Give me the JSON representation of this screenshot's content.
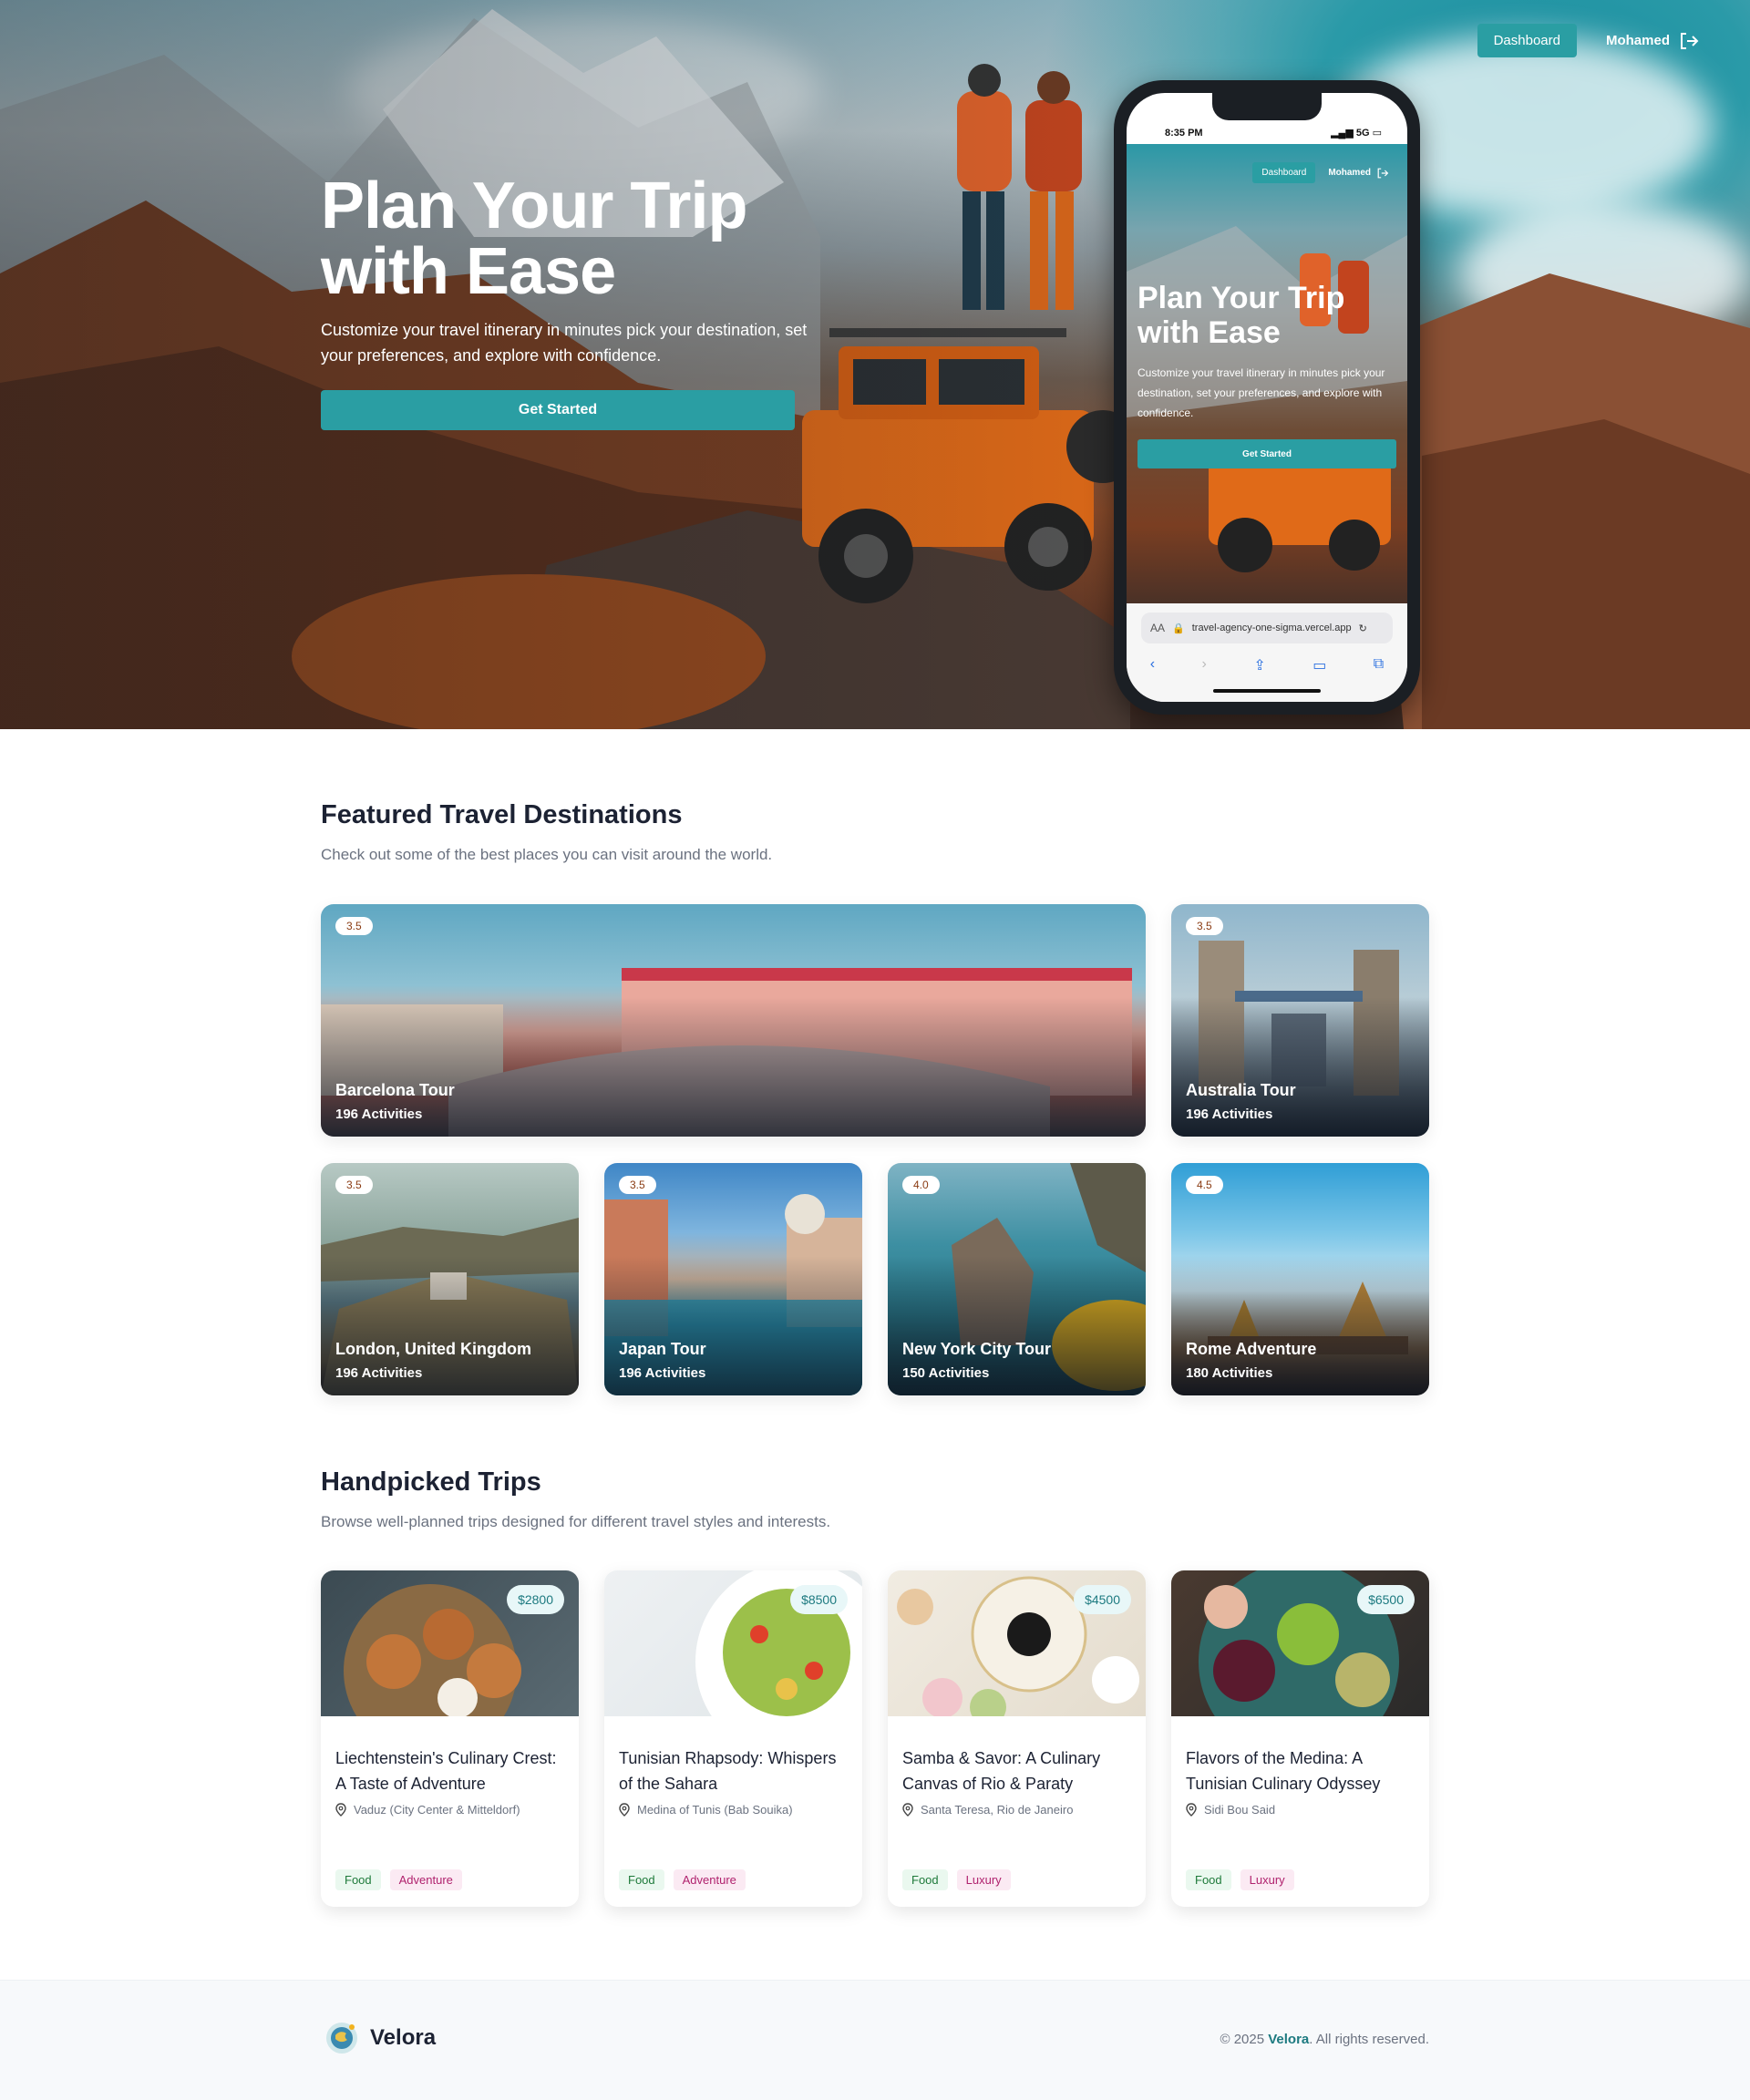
{
  "hero": {
    "nav": {
      "dashboard_label": "Dashboard",
      "user_name": "Mohamed"
    },
    "title": "Plan Your Trip with Ease",
    "subtitle": "Customize your travel itinerary in minutes pick your destination, set your preferences, and explore with confidence.",
    "cta_label": "Get Started"
  },
  "phone": {
    "time": "8:35 PM",
    "signal": "5G",
    "nav": {
      "dashboard_label": "Dashboard",
      "user_name": "Mohamed"
    },
    "title": "Plan Your Trip with Ease",
    "subtitle": "Customize your travel itinerary in minutes pick your destination, set your preferences, and explore with confidence.",
    "cta_label": "Get Started",
    "url_prefix": "AA",
    "url": "travel-agency-one-sigma.vercel.app"
  },
  "featured": {
    "title": "Featured Travel Destinations",
    "subtitle": "Check out some of the best places you can visit around the world.",
    "items": [
      {
        "rating": "3.5",
        "name": "Barcelona Tour",
        "activities": "196 Activities"
      },
      {
        "rating": "3.5",
        "name": "Australia Tour",
        "activities": "196 Activities"
      },
      {
        "rating": "3.5",
        "name": "London, United Kingdom",
        "activities": "196 Activities"
      },
      {
        "rating": "3.5",
        "name": "Japan Tour",
        "activities": "196 Activities"
      },
      {
        "rating": "4.0",
        "name": "New York City Tour",
        "activities": "150 Activities"
      },
      {
        "rating": "4.5",
        "name": "Rome Adventure",
        "activities": "180 Activities"
      }
    ]
  },
  "trips": {
    "title": "Handpicked Trips",
    "subtitle": "Browse well-planned trips designed for different travel styles and interests.",
    "items": [
      {
        "price": "$2800",
        "title": "Liechtenstein's Culinary Crest: A Taste of Adventure",
        "location": "Vaduz (City Center & Mitteldorf)",
        "tags": [
          "Food",
          "Adventure"
        ]
      },
      {
        "price": "$8500",
        "title": "Tunisian Rhapsody: Whispers of the Sahara",
        "location": "Medina of Tunis (Bab Souika)",
        "tags": [
          "Food",
          "Adventure"
        ]
      },
      {
        "price": "$4500",
        "title": "Samba & Savor: A Culinary Canvas of Rio & Paraty",
        "location": "Santa Teresa, Rio de Janeiro",
        "tags": [
          "Food",
          "Luxury"
        ]
      },
      {
        "price": "$6500",
        "title": "Flavors of the Medina: A Tunisian Culinary Odyssey",
        "location": "Sidi Bou Said",
        "tags": [
          "Food",
          "Luxury"
        ]
      }
    ]
  },
  "footer": {
    "brand": "Velora",
    "copyright_prefix": "© 2025",
    "copyright_brand": "Velora",
    "copyright_suffix": ". All rights reserved."
  },
  "colors": {
    "accent": "#2a9ea3",
    "accent_text": "#1d7a80",
    "tag_food": "#1e7a3a",
    "tag_pink": "#b0226e",
    "heading": "#1c2233"
  }
}
